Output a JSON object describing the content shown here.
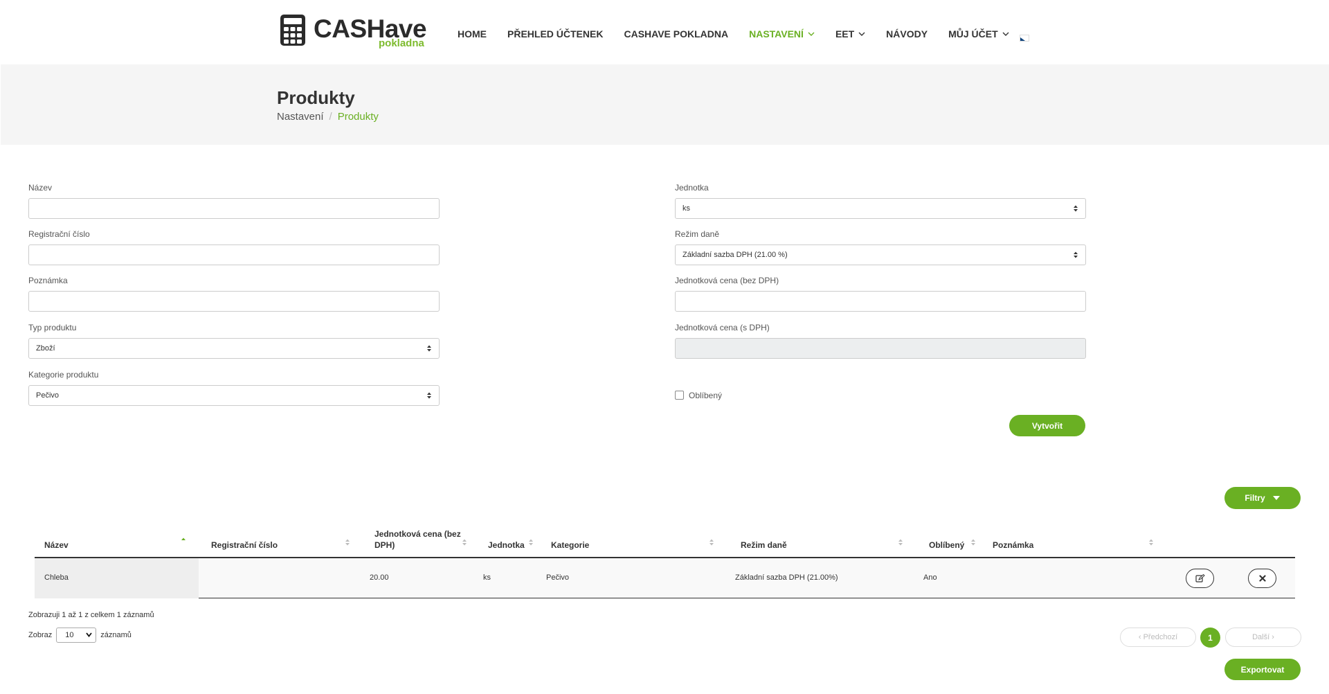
{
  "brand": {
    "name": "CASHave",
    "sub": "pokladna"
  },
  "nav": {
    "items": [
      {
        "label": "HOME"
      },
      {
        "label": "PŘEHLED ÚČTENEK"
      },
      {
        "label": "CASHAVE POKLADNA"
      },
      {
        "label": "NASTAVENÍ"
      },
      {
        "label": "EET"
      },
      {
        "label": "NÁVODY"
      },
      {
        "label": "MŮJ ÚČET"
      }
    ],
    "active": "NASTAVENÍ"
  },
  "page": {
    "title": "Produkty"
  },
  "breadcrumb": {
    "parent": "Nastavení",
    "separator": "/",
    "current": "Produkty"
  },
  "form": {
    "nazev": {
      "label": "Název",
      "value": ""
    },
    "registracni_cislo": {
      "label": "Registrační číslo",
      "value": ""
    },
    "poznamka": {
      "label": "Poznámka",
      "value": ""
    },
    "typ_produktu": {
      "label": "Typ produktu",
      "value": "Zboží"
    },
    "kategorie": {
      "label": "Kategorie produktu",
      "value": "Pečivo"
    },
    "jednotka": {
      "label": "Jednotka",
      "value": "ks"
    },
    "rezim_dane": {
      "label": "Režim daně",
      "value": "Základní sazba DPH (21.00 %)"
    },
    "cena_bez_dph": {
      "label": "Jednotková cena (bez DPH)",
      "value": ""
    },
    "cena_s_dph": {
      "label": "Jednotková cena (s DPH)",
      "value": ""
    },
    "oblibeny": {
      "label": "Oblíbený",
      "checked": false
    },
    "submit_label": "Vytvořit"
  },
  "filters": {
    "label": "Filtry"
  },
  "table": {
    "columns": [
      "Název",
      "Registrační číslo",
      "Jednotková cena (bez",
      "DPH)",
      "Jednotka",
      "Kategorie",
      "Režim daně",
      "Oblíbený",
      "Poznámka"
    ],
    "rows": [
      {
        "nazev": "Chleba",
        "registracni_cislo": "",
        "cena": "20.00",
        "jednotka": "ks",
        "kategorie": "Pečivo",
        "rezim_dane": "Základní sazba DPH (21.00%)",
        "oblibeny": "Ano",
        "poznamka": ""
      }
    ]
  },
  "info": "Zobrazuji 1 až 1 z celkem 1 záznamů",
  "length": {
    "prefix": "Zobraz",
    "value": "10",
    "suffix": "záznamů"
  },
  "pagination": {
    "prev": "‹ Předchozí",
    "page": "1",
    "next": "Další ›"
  },
  "export_label": "Exportovat",
  "colors": {
    "accent": "#6ab023",
    "band": "#f5f5f5"
  }
}
